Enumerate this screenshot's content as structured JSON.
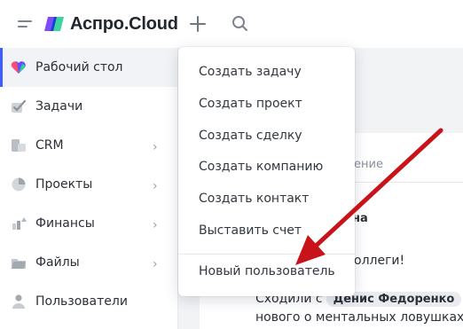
{
  "app": {
    "name": "Аспро.Cloud"
  },
  "sidebar": {
    "items": [
      {
        "label": "Рабочий стол",
        "icon": "dashboard-icon",
        "active": true,
        "has_submenu": false
      },
      {
        "label": "Задачи",
        "icon": "tasks-icon",
        "active": false,
        "has_submenu": false
      },
      {
        "label": "CRM",
        "icon": "crm-icon",
        "active": false,
        "has_submenu": true
      },
      {
        "label": "Проекты",
        "icon": "projects-icon",
        "active": false,
        "has_submenu": true
      },
      {
        "label": "Финансы",
        "icon": "finance-icon",
        "active": false,
        "has_submenu": true
      },
      {
        "label": "Файлы",
        "icon": "files-icon",
        "active": false,
        "has_submenu": true
      },
      {
        "label": "Пользователи",
        "icon": "users-icon",
        "active": false,
        "has_submenu": false
      }
    ]
  },
  "create_menu": {
    "items": [
      "Создать задачу",
      "Создать проект",
      "Создать сделку",
      "Создать компанию",
      "Создать контакт",
      "Выставить счет",
      "Новый пользователь"
    ]
  },
  "feed": {
    "tab_fragment": "ение",
    "author_fragment": "на",
    "greeting_fragment": "оллеги!",
    "line1_prefix": "Сходили с",
    "mention": "Денис Федоренко",
    "line2": "нового о ментальных ловушках и"
  },
  "colors": {
    "accent": "#3c5dff",
    "annotation_arrow": "#c8131b",
    "logo_purple": "#7b4dff",
    "logo_green": "#2fd39a"
  }
}
